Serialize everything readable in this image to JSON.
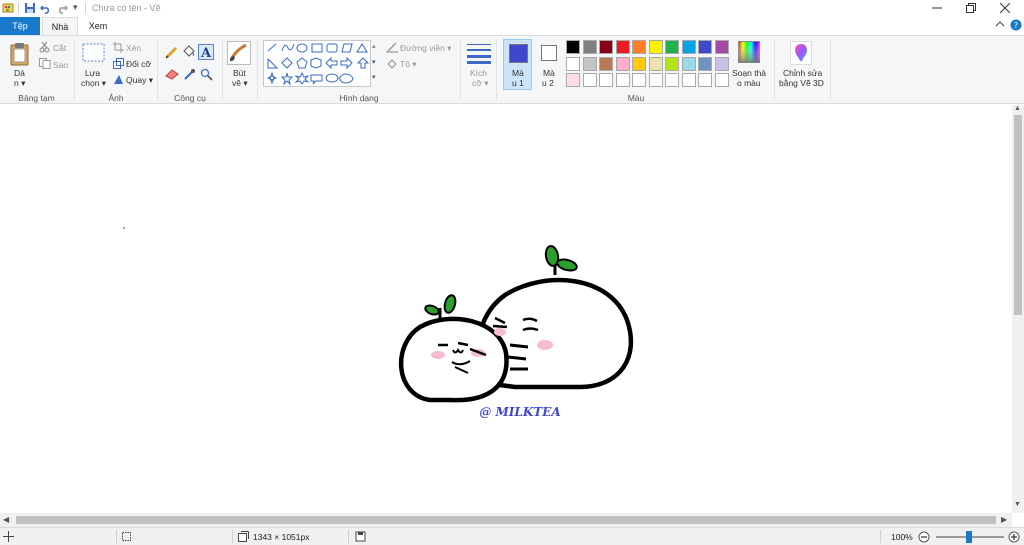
{
  "title_bar": {
    "title": "Chưa có tên - Vẽ",
    "qat_dropdown": "▾"
  },
  "tabs": [
    {
      "label": "Tệp"
    },
    {
      "label": "Nhà"
    },
    {
      "label": "Xem"
    }
  ],
  "ribbon": {
    "clipboard": {
      "paste": "Dá",
      "paste2": "n",
      "cut": "Cắt",
      "copy": "Sao",
      "group": "Bảng tạm"
    },
    "image": {
      "select": "Lựa",
      "select2": "chọn",
      "crop": "Xén",
      "resize": "Đổi cỡ",
      "rotate": "Quay",
      "group": "Ảnh"
    },
    "tools": {
      "group": "Công cụ"
    },
    "brushes": {
      "label": "Bút",
      "label2": "vẽ"
    },
    "shapes": {
      "outline": "Đường viền",
      "fill": "Tô",
      "group": "Hình dạng"
    },
    "size": {
      "label": "Kích",
      "label2": "cỡ"
    },
    "color1": {
      "label": "Mà",
      "label2": "u 1",
      "color": "#3f48cc"
    },
    "color2": {
      "label": "Mà",
      "label2": "u 2",
      "color": "#ffffff"
    },
    "palette": {
      "row1": [
        "#000000",
        "#7f7f7f",
        "#880015",
        "#ed1c24",
        "#ff7f27",
        "#fff200",
        "#22b14c",
        "#00a2e8",
        "#3f48cc",
        "#a349a4"
      ],
      "row2": [
        "#ffffff",
        "#c3c3c3",
        "#b97a57",
        "#ffaec9",
        "#ffc90e",
        "#efe4b0",
        "#b5e61d",
        "#99d9ea",
        "#7092be",
        "#c8bfe7"
      ],
      "row3": [
        "#ffdde6",
        "#ffffff",
        "#ffffff",
        "#ffffff",
        "#ffffff",
        "#ffffff",
        "#ffffff",
        "#ffffff",
        "#ffffff",
        "#ffffff"
      ],
      "group": "Màu"
    },
    "edit_colors": {
      "label": "Soạn thả",
      "label2": "o màu"
    },
    "paint3d": {
      "label": "Chỉnh sửa",
      "label2": "bằng Vẽ 3D"
    }
  },
  "drawing": {
    "signature": "@ MILKTEA"
  },
  "status": {
    "dimensions": "1343 × 1051px",
    "zoom": "100%"
  }
}
